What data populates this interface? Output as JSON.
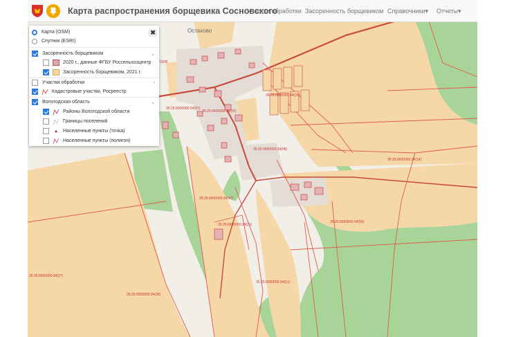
{
  "header": {
    "title": "Карта распространения борщевика Сосновского",
    "nav": [
      {
        "label": "Участки обработки"
      },
      {
        "label": "Засоренность борщевиком"
      },
      {
        "label": "Справочники"
      },
      {
        "label": "Отчеты"
      }
    ],
    "dropdown_glyph": "▾",
    "logo_icons": [
      "coat-of-arms-icon",
      "wheat-emblem-icon"
    ]
  },
  "layers_panel": {
    "close_glyph": "✖",
    "basemaps": [
      {
        "label": "Карта (OSM)",
        "selected": true
      },
      {
        "label": "Спутник (ESRI)",
        "selected": false
      }
    ],
    "groups": [
      {
        "label": "Засоренность борщевиком",
        "checked": true,
        "expanded": true,
        "items": [
          {
            "label": "2020 г., данные ФГБУ Россельхозцентр",
            "checked": false,
            "swatch": "#d8a9b0"
          },
          {
            "label": "Засоренность борщевиком, 2021 г.",
            "checked": true,
            "swatch": "#f6d7a7"
          }
        ]
      },
      {
        "label": "Участки обработки",
        "checked": false,
        "expanded": false,
        "items": []
      },
      {
        "label": "Кадастровые участки, Росреестр",
        "checked": true,
        "is_layer": true,
        "icon": "parcel-line-icon"
      },
      {
        "label": "Вологодская область",
        "checked": true,
        "expanded": true,
        "items": [
          {
            "label": "Районы Вологодской области",
            "checked": true,
            "icon": "district-line-icon"
          },
          {
            "label": "Границы поселений",
            "checked": false,
            "icon": "settlement-border-icon"
          },
          {
            "label": "Населенные пункты (точка)",
            "checked": false,
            "icon": "point-icon"
          },
          {
            "label": "Населенные пункты (полигон)",
            "checked": false,
            "icon": "polygon-line-icon"
          }
        ]
      }
    ],
    "chevron_down": "⌄",
    "chevron_right": "›"
  },
  "map": {
    "colors": {
      "background": "#f2efe9",
      "infestation_fill": "#f6d7a7",
      "forest": "#a8d49a",
      "parcel_line": "#e05a4a",
      "road": "#c94a3a",
      "building": "#e4b3b3"
    },
    "place_labels": [
      "Остахово"
    ],
    "parcel_labels": [
      "35:25:0000000:34(98)",
      "35:25:0000000:34(14)",
      "35:25:0000000:34(42)",
      "35:25:0000000:34(21)",
      "35:25:0000000:34(50)",
      "35:25:0000000:34(51)",
      "35:25:0000000:34(38)",
      "35:25:0000000:34(27)",
      "35:25:0000000:34(97)",
      "35:25:0000000:34(29)",
      "35:25:0000000:34(20)",
      "0208"
    ]
  }
}
